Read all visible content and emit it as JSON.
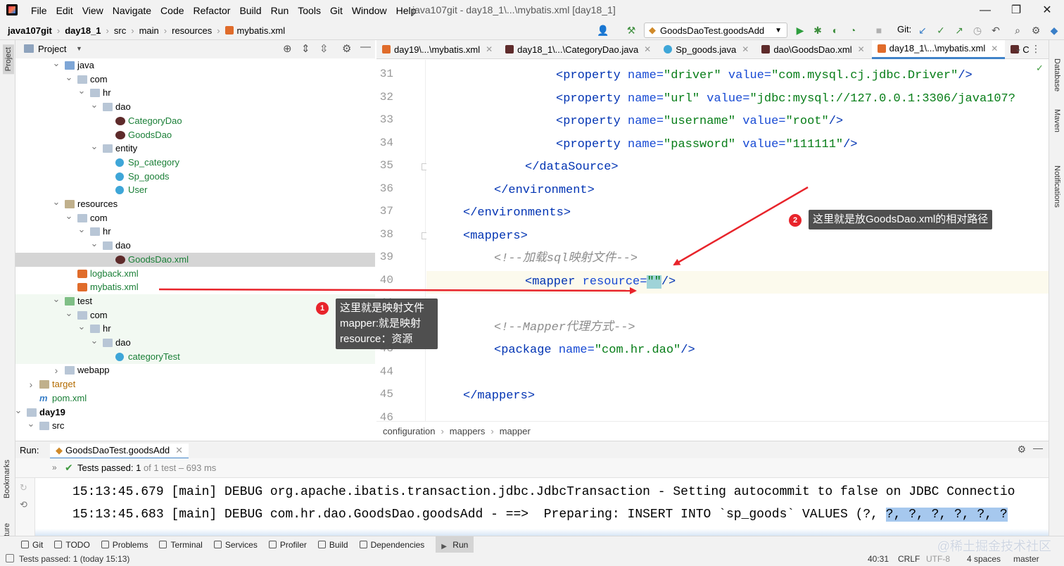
{
  "menu": {
    "items": [
      "File",
      "Edit",
      "View",
      "Navigate",
      "Code",
      "Refactor",
      "Build",
      "Run",
      "Tools",
      "Git",
      "Window",
      "Help"
    ],
    "title": "java107git - day18_1\\...\\mybatis.xml [day18_1]"
  },
  "nav": {
    "breadcrumb": [
      "java107git",
      "day18_1",
      "src",
      "main",
      "resources",
      "mybatis.xml"
    ],
    "run_config": "GoodsDaoTest.goodsAdd",
    "git_label": "Git:"
  },
  "project": {
    "title": "Project",
    "tree": [
      {
        "label": "java",
        "depth": 4,
        "icon": "folder-src",
        "expanded": true
      },
      {
        "label": "com",
        "depth": 5,
        "icon": "folder",
        "expanded": true
      },
      {
        "label": "hr",
        "depth": 6,
        "icon": "folder",
        "expanded": true
      },
      {
        "label": "dao",
        "depth": 7,
        "icon": "folder",
        "expanded": true
      },
      {
        "label": "CategoryDao",
        "depth": 8,
        "icon": "mybatis",
        "color": "green"
      },
      {
        "label": "GoodsDao",
        "depth": 8,
        "icon": "mybatis",
        "color": "green"
      },
      {
        "label": "entity",
        "depth": 7,
        "icon": "folder",
        "expanded": true
      },
      {
        "label": "Sp_category",
        "depth": 8,
        "icon": "class",
        "color": "green"
      },
      {
        "label": "Sp_goods",
        "depth": 8,
        "icon": "class",
        "color": "green"
      },
      {
        "label": "User",
        "depth": 8,
        "icon": "class",
        "color": "green"
      },
      {
        "label": "resources",
        "depth": 4,
        "icon": "folder-res",
        "expanded": true
      },
      {
        "label": "com",
        "depth": 5,
        "icon": "folder",
        "expanded": true
      },
      {
        "label": "hr",
        "depth": 6,
        "icon": "folder",
        "expanded": true
      },
      {
        "label": "dao",
        "depth": 7,
        "icon": "folder",
        "expanded": true
      },
      {
        "label": "GoodsDao.xml",
        "depth": 8,
        "icon": "mybatis",
        "color": "green",
        "selected": true
      },
      {
        "label": "logback.xml",
        "depth": 5,
        "icon": "xml",
        "color": "green"
      },
      {
        "label": "mybatis.xml",
        "depth": 5,
        "icon": "xml",
        "color": "green"
      },
      {
        "label": "test",
        "depth": 4,
        "icon": "folder-test",
        "expanded": true
      },
      {
        "label": "com",
        "depth": 5,
        "icon": "folder",
        "expanded": true
      },
      {
        "label": "hr",
        "depth": 6,
        "icon": "folder",
        "expanded": true
      },
      {
        "label": "dao",
        "depth": 7,
        "icon": "folder",
        "expanded": true
      },
      {
        "label": "categoryTest",
        "depth": 8,
        "icon": "class",
        "color": "green"
      },
      {
        "label": "webapp",
        "depth": 4,
        "icon": "folder",
        "expanded": false
      },
      {
        "label": "target",
        "depth": 2,
        "icon": "folder-target",
        "expanded": false,
        "color": "orange"
      },
      {
        "label": "pom.xml",
        "depth": 2,
        "icon": "maven",
        "color": "green"
      },
      {
        "label": "day19",
        "depth": 1,
        "icon": "module",
        "expanded": true,
        "bold": true
      },
      {
        "label": "src",
        "depth": 2,
        "icon": "folder",
        "expanded": true
      }
    ]
  },
  "tabs": [
    {
      "label": "day19\\...\\mybatis.xml",
      "icon": "xml"
    },
    {
      "label": "day18_1\\...\\CategoryDao.java",
      "icon": "mybatis"
    },
    {
      "label": "Sp_goods.java",
      "icon": "class"
    },
    {
      "label": "dao\\GoodsDao.xml",
      "icon": "mybatis"
    },
    {
      "label": "day18_1\\...\\mybatis.xml",
      "icon": "xml",
      "active": true
    },
    {
      "label": "C",
      "icon": "mybatis"
    }
  ],
  "editor": {
    "lines": [
      {
        "n": "31",
        "indent": 8,
        "parts": [
          [
            "tag",
            "<property "
          ],
          [
            "attr",
            "name="
          ],
          [
            "val",
            "\"driver\" "
          ],
          [
            "attr",
            "value="
          ],
          [
            "val",
            "\"com.mysql.cj.jdbc.Driver\""
          ],
          [
            "tag",
            "/>"
          ]
        ]
      },
      {
        "n": "32",
        "indent": 8,
        "parts": [
          [
            "tag",
            "<property "
          ],
          [
            "attr",
            "name="
          ],
          [
            "val",
            "\"url\" "
          ],
          [
            "attr",
            "value="
          ],
          [
            "val",
            "\"jdbc:mysql://127.0.0.1:3306/java107?"
          ]
        ]
      },
      {
        "n": "33",
        "indent": 8,
        "parts": [
          [
            "tag",
            "<property "
          ],
          [
            "attr",
            "name="
          ],
          [
            "val",
            "\"username\" "
          ],
          [
            "attr",
            "value="
          ],
          [
            "val",
            "\"root\""
          ],
          [
            "tag",
            "/>"
          ]
        ]
      },
      {
        "n": "34",
        "indent": 8,
        "parts": [
          [
            "tag",
            "<property "
          ],
          [
            "attr",
            "name="
          ],
          [
            "val",
            "\"password\" "
          ],
          [
            "attr",
            "value="
          ],
          [
            "val",
            "\"111111\""
          ],
          [
            "tag",
            "/>"
          ]
        ]
      },
      {
        "n": "35",
        "indent": 6,
        "parts": [
          [
            "tag",
            "</dataSource>"
          ]
        ]
      },
      {
        "n": "36",
        "indent": 4,
        "parts": [
          [
            "tag",
            "</environment>"
          ]
        ]
      },
      {
        "n": "37",
        "indent": 2,
        "parts": [
          [
            "tag",
            "</environments>"
          ]
        ]
      },
      {
        "n": "38",
        "indent": 2,
        "parts": [
          [
            "tag",
            "<mappers>"
          ]
        ]
      },
      {
        "n": "39",
        "indent": 4,
        "parts": [
          [
            "cmt",
            "<!--加载sql映射文件-->"
          ]
        ]
      },
      {
        "n": "40",
        "indent": 6,
        "parts": [
          [
            "tag",
            "<mapper "
          ],
          [
            "attr",
            "resource="
          ],
          [
            "val",
            "\"\""
          ],
          [
            "tag",
            "/>"
          ]
        ],
        "current": true
      },
      {
        "n": "41",
        "indent": 0,
        "parts": []
      },
      {
        "n": "42",
        "indent": 4,
        "parts": [
          [
            "cmt",
            "<!--Mapper代理方式-->"
          ]
        ]
      },
      {
        "n": "43",
        "indent": 4,
        "parts": [
          [
            "tag",
            "<package "
          ],
          [
            "attr",
            "name="
          ],
          [
            "val",
            "\"com.hr.dao\""
          ],
          [
            "tag",
            "/>"
          ]
        ]
      },
      {
        "n": "44",
        "indent": 0,
        "parts": []
      },
      {
        "n": "45",
        "indent": 2,
        "parts": [
          [
            "tag",
            "</mappers>"
          ]
        ]
      },
      {
        "n": "46",
        "indent": 0,
        "parts": []
      }
    ],
    "crumbs": [
      "configuration",
      "mappers",
      "mapper"
    ]
  },
  "run": {
    "label": "Run:",
    "config": "GoodsDaoTest.goodsAdd",
    "tests_passed": "Tests passed: ",
    "count": "1",
    "of": " of 1 test – 693 ms",
    "console": [
      "15:13:45.679 [main] DEBUG org.apache.ibatis.transaction.jdbc.JdbcTransaction - Setting autocommit to false on JDBC Connectio",
      "15:13:45.683 [main] DEBUG com.hr.dao.GoodsDao.goodsAdd - ==>  Preparing: INSERT INTO `sp_goods` VALUES (?, ?, ?, ?, ?, ?, ?"
    ]
  },
  "toolwindows": [
    "Git",
    "TODO",
    "Problems",
    "Terminal",
    "Services",
    "Profiler",
    "Build",
    "Dependencies",
    "Run"
  ],
  "status": {
    "left": "Tests passed: 1 (today 15:13)",
    "pos": "40:31",
    "eol": "CRLF",
    "enc": "UTF-8",
    "indent": "4 spaces",
    "branch": "master"
  },
  "stripes": {
    "left": [
      "Project",
      "Bookmarks",
      "Structure"
    ],
    "right": [
      "Database",
      "Maven",
      "Notifications"
    ]
  },
  "annotations": {
    "a1": {
      "num": "1",
      "lines": [
        "这里就是映射文件",
        "mapper:就是映射",
        "resource：资源"
      ]
    },
    "a2": {
      "num": "2",
      "text": "这里就是放GoodsDao.xml的相对路径"
    }
  },
  "watermark": "@稀土掘金技术社区",
  "colors": {
    "accent": "#4083c9",
    "annotation_bg": "#4a4a4a",
    "arrow": "#e8242b",
    "tag": "#0033b3",
    "value": "#067d17",
    "comment": "#8c8c8c"
  }
}
